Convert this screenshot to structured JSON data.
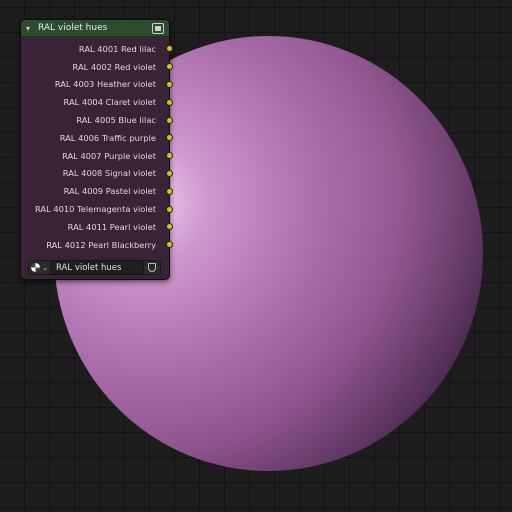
{
  "node": {
    "title": "RAL violet hues",
    "collapse_glyph": "▾",
    "header_color": "#2c4b2f",
    "body_color": "#3a2337",
    "socket_color": "#c7c729",
    "outputs": [
      "RAL 4001 Red lilac",
      "RAL 4002 Red violet",
      "RAL 4003 Heather violet",
      "RAL 4004 Claret violet",
      "RAL 4005 Blue lilac",
      "RAL 4006 Traffic purple",
      "RAL 4007 Purple violet",
      "RAL 4008 Signal violet",
      "RAL 4009 Pastel violet",
      "RAL 4010 Telemagenta violet",
      "RAL 4011 Pearl violet",
      "RAL 4012 Pearl Blackberry"
    ],
    "group_selector_arrow": "⌄",
    "group_name": "RAL violet hues"
  },
  "preview": {
    "sphere_color": "#ad6fae"
  }
}
